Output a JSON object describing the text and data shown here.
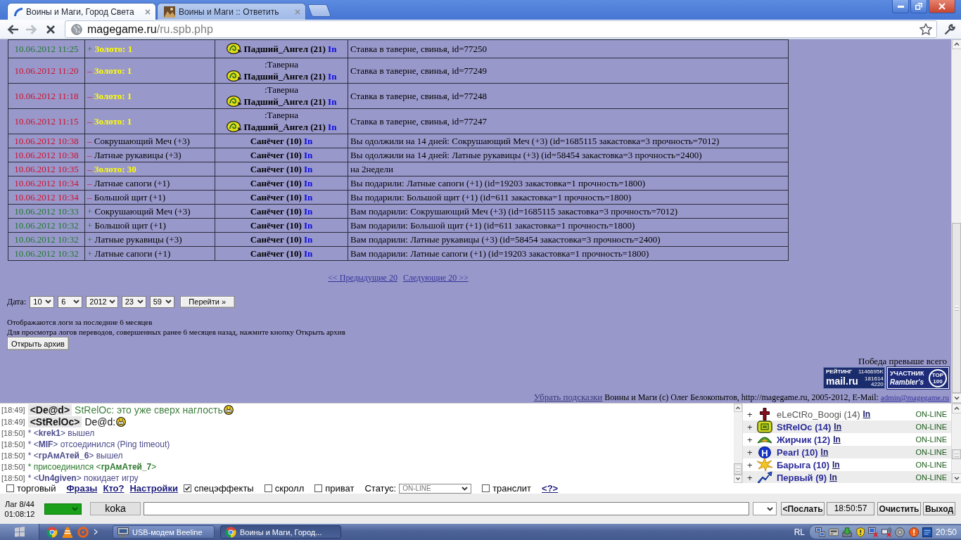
{
  "browser": {
    "tabs": [
      {
        "title": "Воины и Маги, Город Света",
        "selected": true,
        "loading": true
      },
      {
        "title": "Воины и Маги :: Ответить",
        "selected": false,
        "loading": false
      }
    ],
    "loading": true,
    "address": {
      "host": "magegame.ru",
      "path": "/ru.spb.php"
    }
  },
  "log": {
    "rows": [
      {
        "date": "10.06.2012 11:25",
        "incoming": true,
        "sign": "+",
        "item": {
          "kind": "gold",
          "name": "Золото: 1"
        },
        "emblem": true,
        "player": "Падший_Ангел (21)",
        "link": "In",
        "description": "Ставка в таверне, свинья, id=77250"
      },
      {
        "date": "10.06.2012 11:20",
        "incoming": false,
        "sign": "–",
        "item": {
          "kind": "gold",
          "name": "Золото: 1"
        },
        "location": ":Таверна",
        "emblem": true,
        "player": "Падший_Ангел (21)",
        "link": "In",
        "description": "Ставка в таверне, свинья, id=77249"
      },
      {
        "date": "10.06.2012 11:18",
        "incoming": false,
        "sign": "–",
        "item": {
          "kind": "gold",
          "name": "Золото: 1"
        },
        "location": ":Таверна",
        "emblem": true,
        "player": "Падший_Ангел (21)",
        "link": "In",
        "description": "Ставка в таверне, свинья, id=77248"
      },
      {
        "date": "10.06.2012 11:15",
        "incoming": false,
        "sign": "–",
        "item": {
          "kind": "gold",
          "name": "Золото: 1"
        },
        "location": ":Таверна",
        "emblem": true,
        "player": "Падший_Ангел (21)",
        "link": "In",
        "description": "Ставка в таверне, свинья, id=77247"
      },
      {
        "date": "10.06.2012 10:38",
        "incoming": false,
        "sign": "–",
        "item": {
          "kind": "item",
          "name": "Сокрушающий Меч (+3)"
        },
        "emblem": false,
        "player": "Санёчег (10)",
        "link": "In",
        "description": "Вы одолжили на 14 дней: Сокрушающий Меч (+3) (id=1685115 закастовка=3 прочность=7012)"
      },
      {
        "date": "10.06.2012 10:38",
        "incoming": false,
        "sign": "–",
        "item": {
          "kind": "item",
          "name": "Латные рукавицы (+3)"
        },
        "emblem": false,
        "player": "Санёчег (10)",
        "link": "In",
        "description": "Вы одолжили на 14 дней: Латные рукавицы (+3) (id=58454 закастовка=3 прочность=2400)"
      },
      {
        "date": "10.06.2012 10:35",
        "incoming": false,
        "sign": "–",
        "item": {
          "kind": "gold",
          "name": "Золото: 30"
        },
        "emblem": false,
        "player": "Санёчег (10)",
        "link": "In",
        "description": "на 2недели"
      },
      {
        "date": "10.06.2012 10:34",
        "incoming": false,
        "sign": "–",
        "item": {
          "kind": "item",
          "name": "Латные сапоги (+1)"
        },
        "emblem": false,
        "player": "Санёчег (10)",
        "link": "In",
        "description": "Вы подарили: Латные сапоги (+1) (id=19203 закастовка=1 прочность=1800)"
      },
      {
        "date": "10.06.2012 10:34",
        "incoming": false,
        "sign": "–",
        "item": {
          "kind": "item",
          "name": "Большой щит (+1)"
        },
        "emblem": false,
        "player": "Санёчег (10)",
        "link": "In",
        "description": "Вы подарили: Большой щит (+1) (id=611 закастовка=1 прочность=1800)"
      },
      {
        "date": "10.06.2012 10:33",
        "incoming": true,
        "sign": "+",
        "item": {
          "kind": "item",
          "name": "Сокрушающий Меч (+3)"
        },
        "emblem": false,
        "player": "Санёчег (10)",
        "link": "In",
        "description": "Вам подарили: Сокрушающий Меч (+3) (id=1685115 закастовка=3 прочность=7012)"
      },
      {
        "date": "10.06.2012 10:32",
        "incoming": true,
        "sign": "+",
        "item": {
          "kind": "item",
          "name": "Большой щит (+1)"
        },
        "emblem": false,
        "player": "Санёчег (10)",
        "link": "In",
        "description": "Вам подарили: Большой щит (+1) (id=611 закастовка=1 прочность=1800)"
      },
      {
        "date": "10.06.2012 10:32",
        "incoming": true,
        "sign": "+",
        "item": {
          "kind": "item",
          "name": "Латные рукавицы (+3)"
        },
        "emblem": false,
        "player": "Санёчег (10)",
        "link": "In",
        "description": "Вам подарили: Латные рукавицы (+3) (id=58454 закастовка=3 прочность=2400)"
      },
      {
        "date": "10.06.2012 10:32",
        "incoming": true,
        "sign": "+",
        "item": {
          "kind": "item",
          "name": "Латные сапоги (+1)"
        },
        "emblem": false,
        "player": "Санёчег (10)",
        "link": "In",
        "description": "Вам подарили: Латные сапоги (+1) (id=19203 закастовка=1 прочность=1800)"
      }
    ]
  },
  "pager": {
    "links": [
      "<< Предыдущие 20",
      "Следующие 20 >>"
    ]
  },
  "date_form": {
    "label": "Дата:",
    "selects": [
      "10",
      "6",
      "2012",
      "23",
      "59"
    ],
    "button": "Перейти »"
  },
  "notes": [
    "Отображаются логи за последние 6 месяцев",
    "Для просмотра логов переводов, совершенных ранее 6 месяцев назад, нажмите кнопку Открыть архив"
  ],
  "archive_button": "Открыть архив",
  "footer": {
    "motto": "Победа превыше всего",
    "rating_counter": {
      "title": "РЕЙТИНГ",
      "logo": "mail.ru",
      "values": [
        "1146695K",
        "181614",
        "4220"
      ]
    },
    "top_counter": {
      "label": "УЧАСТНИК",
      "logo": "Rambler's",
      "badge": "TOP 100"
    },
    "hide_hints_link": "Убрать подсказки",
    "copyright": "Воины и Маги (c) Олег Белокопытов, http://magegame.ru, 2005-2012, E-Mail:",
    "email_link": "admin@magegame.ru"
  },
  "chat": {
    "messages": [
      {
        "kind": "message",
        "time": "[18:49]",
        "nick": "<De@d>",
        "text": "StRelOc: это уже сверх наглость",
        "color": "#3f7f3f",
        "smiley": true
      },
      {
        "kind": "message",
        "time": "[18:49]",
        "nick": "<StRelOc>",
        "text": "De@d:",
        "color": "#111111",
        "smiley": true
      },
      {
        "kind": "event",
        "time": "[18:50]",
        "text": "* <**krek1**> вышел",
        "color": "#4a4a8c"
      },
      {
        "kind": "event",
        "time": "[18:50]",
        "text": "* <**MIF**> отсоединился (Ping timeout)",
        "color": "#4a4a8c"
      },
      {
        "kind": "event",
        "time": "[18:50]",
        "text": "* <**грАмАтей_6**> вышел",
        "color": "#4a4a8c"
      },
      {
        "kind": "event",
        "time": "[18:50]",
        "text": "* присоединился <**грАмАтей_7**>",
        "color": "#2e7a2e"
      },
      {
        "kind": "event",
        "time": "[18:50]",
        "text": "* <**Un4given**> покидает игру",
        "color": "#4a4a8c"
      }
    ]
  },
  "user_list": [
    {
      "expander": "+",
      "kind": "cross",
      "name": "eLeCtRo_Boogi (14)",
      "link": "In",
      "status": "ON-LINE",
      "dimmed": true
    },
    {
      "expander": "+",
      "kind": "clan",
      "name": "StRelOc (14)",
      "link": "In",
      "status": "ON-LINE",
      "dimmed": false
    },
    {
      "expander": "+",
      "kind": "leaf",
      "name": "Жирчик (12)",
      "link": "In",
      "status": "ON-LINE",
      "dimmed": false
    },
    {
      "expander": "+",
      "kind": "letter",
      "emblem_text": "H",
      "name": "Pearl (10)",
      "link": "In",
      "status": "ON-LINE",
      "dimmed": false
    },
    {
      "expander": "+",
      "kind": "burst",
      "name": "Барыга (10)",
      "link": "In",
      "status": "ON-LINE",
      "dimmed": false
    },
    {
      "expander": "+",
      "kind": "arrow",
      "name": "Первый (9)",
      "link": "In",
      "status": "ON-LINE",
      "dimmed": false
    }
  ],
  "settings": [
    {
      "kind": "checkbox",
      "label": "торговый",
      "checked": false
    },
    {
      "kind": "link",
      "label": "Фразы"
    },
    {
      "kind": "link",
      "label": "Кто?"
    },
    {
      "kind": "link",
      "label": "Настройки"
    },
    {
      "kind": "checkbox",
      "label": "спецэффекты",
      "checked": true
    },
    {
      "kind": "checkbox",
      "label": "скролл",
      "checked": false
    },
    {
      "kind": "checkbox",
      "label": "приват",
      "checked": false
    },
    {
      "kind": "select",
      "label": "Статус:",
      "value": "ON-LINE"
    },
    {
      "kind": "checkbox",
      "label": "транслит",
      "checked": false
    },
    {
      "kind": "link",
      "label": "<?>"
    }
  ],
  "bottom_bar": {
    "lag": "Лаг 8/44",
    "uptime": "01:08:12",
    "nick": "koka",
    "send_button": "<Послать",
    "clock": "18:50:57",
    "clear_button": "Очистить",
    "exit_button": "Выход"
  },
  "taskbar": {
    "tasks": [
      {
        "kind": "monitor",
        "title": "USB-модем Beeline",
        "selected": false
      },
      {
        "kind": "browser",
        "title": "Воины и Маги, Город...",
        "selected": true
      }
    ],
    "language": "RL",
    "clock": "20:50"
  }
}
